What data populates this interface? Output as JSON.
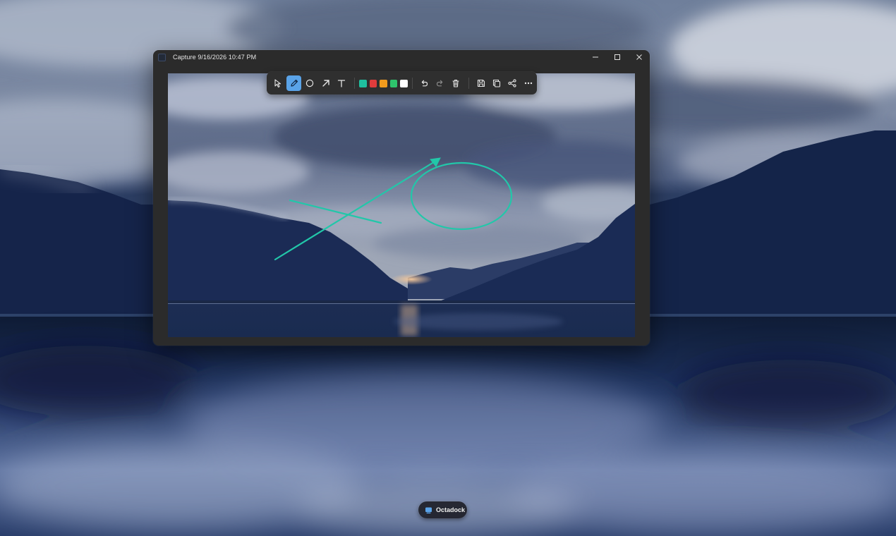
{
  "window": {
    "title": "Capture 9/16/2026 10:47 PM"
  },
  "toolbar": {
    "tools": [
      {
        "name": "select",
        "icon": "cursor-arrow-icon",
        "active": false
      },
      {
        "name": "pen",
        "icon": "pen-icon",
        "active": true
      },
      {
        "name": "ellipse",
        "icon": "circle-icon",
        "active": false
      },
      {
        "name": "arrow",
        "icon": "arrow-up-right-icon",
        "active": false
      },
      {
        "name": "text",
        "icon": "text-icon",
        "active": false
      }
    ],
    "colors": [
      "#1fbf9f",
      "#e03c3c",
      "#f29b1d",
      "#2ec46c",
      "#ffffff"
    ],
    "actions": [
      "undo-icon",
      "redo-icon",
      "trash-icon",
      "save-icon",
      "copy-icon",
      "share-icon",
      "more-icon"
    ]
  },
  "annotation": {
    "stroke_color": "#22c7a9"
  },
  "taskbar": {
    "app_label": "Octadock"
  }
}
